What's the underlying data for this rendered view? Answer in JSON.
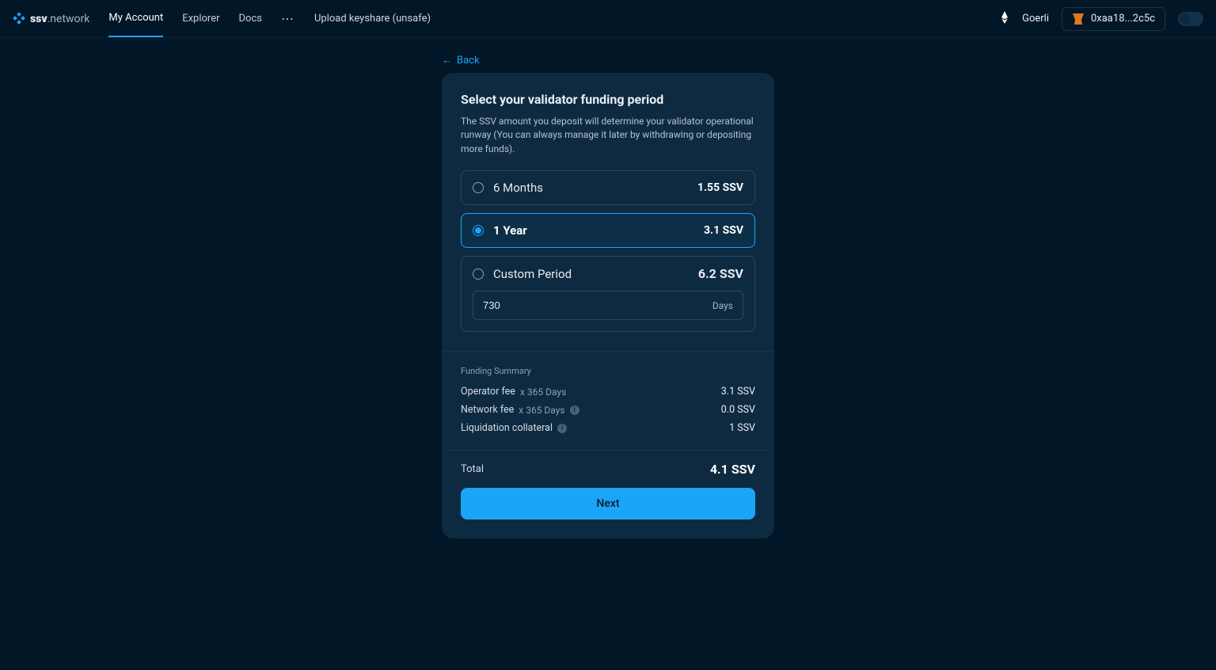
{
  "header": {
    "logo_bold": "ssv",
    "logo_light": ".network",
    "nav": {
      "my_account": "My Account",
      "explorer": "Explorer",
      "docs": "Docs"
    },
    "upload": "Upload keyshare (unsafe)",
    "network": "Goerli",
    "wallet": "0xaa18...2c5c"
  },
  "back": "Back",
  "card": {
    "title": "Select your validator funding period",
    "subtitle": "The SSV amount you deposit will determine your validator operational runway (You can always manage it later by withdrawing or depositing more funds)."
  },
  "options": {
    "six_months": {
      "label": "6 Months",
      "cost": "1.55 SSV"
    },
    "one_year": {
      "label": "1 Year",
      "cost": "3.1 SSV"
    },
    "custom": {
      "label": "Custom Period",
      "cost": "6.2 SSV",
      "value": "730",
      "suffix": "Days"
    }
  },
  "summary": {
    "title": "Funding Summary",
    "operator_fee_label": "Operator fee",
    "operator_fee_mult": "x 365 Days",
    "operator_fee_value": "3.1 SSV",
    "network_fee_label": "Network fee",
    "network_fee_mult": "x 365 Days",
    "network_fee_value": "0.0 SSV",
    "liq_label": "Liquidation collateral",
    "liq_value": "1 SSV"
  },
  "total": {
    "label": "Total",
    "value": "4.1 SSV"
  },
  "next": "Next"
}
